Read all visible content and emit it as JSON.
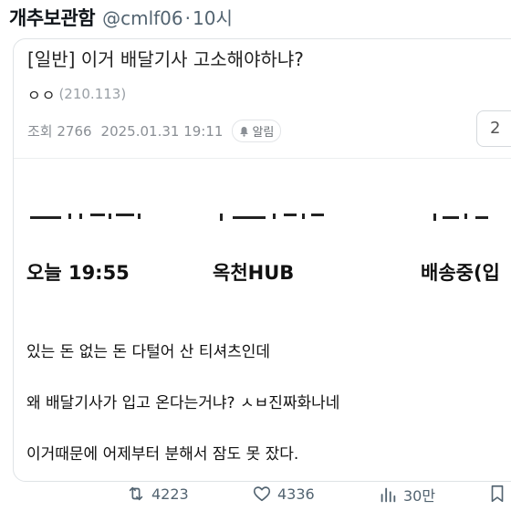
{
  "tweet": {
    "author_name": "개추보관함",
    "handle": "@cmlf06",
    "separator": "·",
    "time": "10시"
  },
  "post": {
    "title": "[일반] 이거 배달기사 고소해야하냐?",
    "author_nick": "ㅇㅇ",
    "author_ip": "(210.113)",
    "views_label": "조회 2766",
    "datetime": "2025.01.31 19:11",
    "alarm_label": "알림",
    "comment_count": "2"
  },
  "tracking": {
    "time": "오늘 19:55",
    "location": "옥천HUB",
    "status": "배송중(입"
  },
  "body_lines": [
    "있는 돈 없는 돈 다털어 산 티셔츠인데",
    "왜 배달기사가 입고 온다는거냐? ㅅㅂ진짜화나네",
    "이거때문에 어제부터 분해서 잠도 못 잤다."
  ],
  "actions": {
    "retweets": "4223",
    "likes": "4336",
    "views": "30만"
  },
  "colors": {
    "muted": "#536471",
    "border": "#dfe3e6"
  },
  "icons": [
    "retweet-icon",
    "heart-icon",
    "views-chart-icon",
    "bookmark-icon",
    "bell-icon"
  ]
}
